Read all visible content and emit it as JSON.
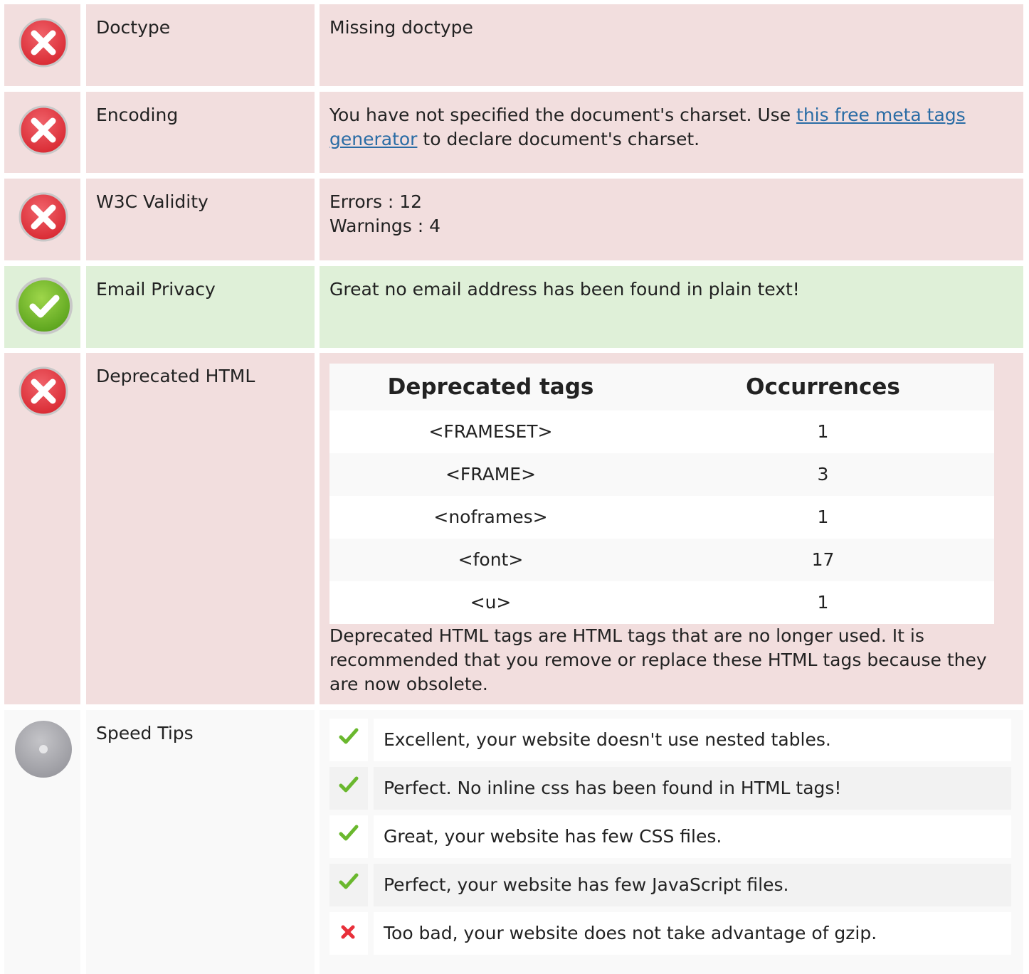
{
  "colors": {
    "error_bg": "#f2dede",
    "success_bg": "#dff0d8",
    "neutral_bg": "#f9f9f9",
    "link": "#2a6ca5",
    "check_green": "#6ab82e",
    "cross_red": "#e8303a"
  },
  "rows": {
    "doctype": {
      "status": "error",
      "icon": "error-cross-icon",
      "label": "Doctype",
      "text": "Missing doctype"
    },
    "encoding": {
      "status": "error",
      "icon": "error-cross-icon",
      "label": "Encoding",
      "text_before": "You have not specified the document's charset. Use ",
      "link_text": "this free meta tags generator",
      "text_after": " to declare document's charset."
    },
    "w3c": {
      "status": "error",
      "icon": "error-cross-icon",
      "label": "W3C Validity",
      "errors": "Errors : 12",
      "warnings": "Warnings : 4"
    },
    "email": {
      "status": "success",
      "icon": "success-check-icon",
      "label": "Email Privacy",
      "text": "Great no email address has been found in plain text!"
    },
    "deprecated": {
      "status": "error",
      "icon": "error-cross-icon",
      "label": "Deprecated HTML",
      "table": {
        "headers": [
          "Deprecated tags",
          "Occurrences"
        ],
        "rows": [
          [
            "<FRAMESET>",
            "1"
          ],
          [
            "<FRAME>",
            "3"
          ],
          [
            "<noframes>",
            "1"
          ],
          [
            "<font>",
            "17"
          ],
          [
            "<u>",
            "1"
          ]
        ]
      },
      "description": "Deprecated HTML tags are HTML tags that are no longer used. It is recommended that you remove or replace these HTML tags because they are now obsolete."
    },
    "speed": {
      "status": "neutral",
      "icon": "neutral-dot-icon",
      "label": "Speed Tips",
      "tips": [
        {
          "icon": "check-icon",
          "text": "Excellent, your website doesn't use nested tables."
        },
        {
          "icon": "check-icon",
          "text": "Perfect. No inline css has been found in HTML tags!"
        },
        {
          "icon": "check-icon",
          "text": "Great, your website has few CSS files."
        },
        {
          "icon": "check-icon",
          "text": "Perfect, your website has few JavaScript files."
        },
        {
          "icon": "cross-icon",
          "text": "Too bad, your website does not take advantage of gzip."
        }
      ]
    }
  }
}
